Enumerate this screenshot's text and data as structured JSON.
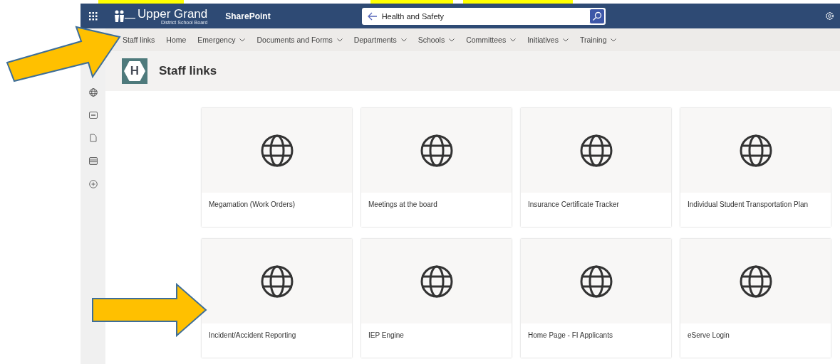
{
  "suite_bar": {
    "logo_name": "Upper Grand",
    "logo_subtitle": "District School Board",
    "app_name": "SharePoint",
    "search": {
      "value": "Health and Safety"
    }
  },
  "nav": [
    {
      "label": "Staff links",
      "dropdown": false
    },
    {
      "label": "Home",
      "dropdown": false
    },
    {
      "label": "Emergency",
      "dropdown": true
    },
    {
      "label": "Documents and Forms",
      "dropdown": true
    },
    {
      "label": "Departments",
      "dropdown": true
    },
    {
      "label": "Schools",
      "dropdown": true
    },
    {
      "label": "Committees",
      "dropdown": true
    },
    {
      "label": "Initiatives",
      "dropdown": true
    },
    {
      "label": "Training",
      "dropdown": true
    }
  ],
  "site": {
    "logo_letter": "H",
    "title": "Staff links"
  },
  "links": [
    {
      "title": "Megamation (Work Orders)"
    },
    {
      "title": "Meetings at the board"
    },
    {
      "title": "Insurance Certificate Tracker"
    },
    {
      "title": "Individual Student Transportation Plan"
    },
    {
      "title": "Incident/Accident Reporting"
    },
    {
      "title": "IEP Engine"
    },
    {
      "title": "Home Page - FI Applicants"
    },
    {
      "title": "eServe Login"
    }
  ]
}
